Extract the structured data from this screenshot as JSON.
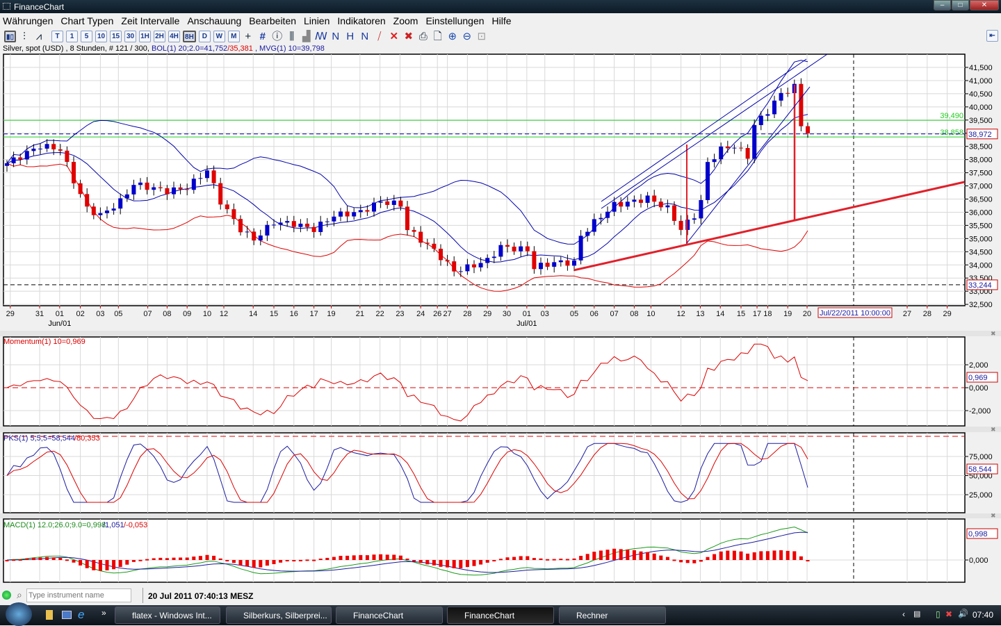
{
  "window": {
    "title": "FinanceChart",
    "controls": [
      "–",
      "□",
      "✕"
    ]
  },
  "menu": [
    "Währungen",
    "Chart Typen",
    "Zeit Intervalle",
    "Anschauung",
    "Bearbeiten",
    "Linien",
    "Indikatoren",
    "Zoom",
    "Einstellungen",
    "Hilfe"
  ],
  "toolbar": {
    "intervals": [
      "T",
      "1",
      "5",
      "10",
      "15",
      "30",
      "1H",
      "2H",
      "4H",
      "8H",
      "D",
      "W",
      "M"
    ],
    "active_interval": "8H"
  },
  "info": {
    "instrument": "Silver, spot (USD) , 8 Stunden, # 121 / 300, ",
    "bol": "BOL(1) 20;2.0=41,752",
    "bol_lower": "/35,381",
    "mvg": " , MVG(1) 10=39,798"
  },
  "colors": {
    "up": "#0000cc",
    "down": "#e00000",
    "band": "#0000aa",
    "lower_band": "#e00000",
    "trend": "#e0202a",
    "level": "#22cc22"
  },
  "chart_data": [
    {
      "type": "candlestick",
      "title": "Silver, spot (USD), 8 Stunden",
      "ylim": [
        32.5,
        41.8
      ],
      "yticks": [
        "41,500",
        "41,000",
        "40,500",
        "40,000",
        "39,500",
        "39,000",
        "38,500",
        "38,000",
        "37,500",
        "37,000",
        "36,500",
        "36,000",
        "35,500",
        "35,000",
        "34,500",
        "34,000",
        "33,500",
        "33,000",
        "32,500"
      ],
      "ytick_values": [
        41.5,
        41,
        40.5,
        40,
        39.5,
        39,
        38.5,
        38,
        37.5,
        37,
        36.5,
        36,
        35.5,
        35,
        34.5,
        34,
        33.5,
        33,
        32.5
      ],
      "xticks": [
        "29",
        "31",
        "01",
        "02",
        "03",
        "05",
        "07",
        "08",
        "09",
        "10",
        "12",
        "14",
        "15",
        "16",
        "17",
        "19",
        "21",
        "22",
        "23",
        "24",
        "26",
        "27",
        "28",
        "29",
        "30",
        "01",
        "03",
        "05",
        "06",
        "07",
        "08",
        "10",
        "12",
        "13",
        "14",
        "15",
        "17",
        "18",
        "19",
        "20",
        "27",
        "28",
        "29"
      ],
      "xtick_index": [
        0.5,
        4.9,
        7.9,
        11,
        14,
        16.7,
        21.1,
        24,
        27,
        30,
        32.5,
        36.9,
        40,
        43,
        46,
        48.6,
        52.9,
        55.9,
        58.9,
        62,
        64.5,
        66,
        69,
        72,
        74.9,
        77.9,
        80.6,
        85,
        88,
        91,
        94,
        96.5,
        101,
        103.9,
        106.9,
        110,
        112.4,
        114,
        117,
        119.9,
        134.9,
        137.9,
        140.9
      ],
      "month_labels": [
        {
          "label": "Jun/01",
          "index": 7.9
        },
        {
          "label": "Jul/01",
          "index": 77.9
        }
      ],
      "cursor_date": "Jul/22/2011 10:00:00",
      "close_keyframes": [
        [
          0,
          37.86
        ],
        [
          5,
          38.52
        ],
        [
          8,
          38.39
        ],
        [
          10,
          37.2
        ],
        [
          12,
          36.14
        ],
        [
          14,
          35.88
        ],
        [
          17,
          36.41
        ],
        [
          19,
          37.07
        ],
        [
          24,
          36.8
        ],
        [
          27,
          36.93
        ],
        [
          30,
          37.6
        ],
        [
          32,
          36.41
        ],
        [
          35,
          35.35
        ],
        [
          37,
          34.96
        ],
        [
          40,
          35.62
        ],
        [
          43,
          35.56
        ],
        [
          46,
          35.35
        ],
        [
          49,
          35.88
        ],
        [
          53,
          36.01
        ],
        [
          56,
          36.41
        ],
        [
          59,
          36.28
        ],
        [
          60,
          35.35
        ],
        [
          64,
          34.56
        ],
        [
          67,
          33.77
        ],
        [
          69,
          33.9
        ],
        [
          72,
          34.17
        ],
        [
          74,
          34.69
        ],
        [
          78,
          34.56
        ],
        [
          79,
          33.9
        ],
        [
          82,
          34.09
        ],
        [
          85,
          34.09
        ],
        [
          86,
          35.09
        ],
        [
          88,
          35.62
        ],
        [
          91,
          36.28
        ],
        [
          94,
          36.41
        ],
        [
          96,
          36.54
        ],
        [
          99,
          36.14
        ],
        [
          101,
          35.35
        ],
        [
          103,
          35.88
        ],
        [
          104,
          36.41
        ],
        [
          105,
          37.86
        ],
        [
          107,
          38.39
        ],
        [
          109,
          38.52
        ],
        [
          111,
          38.12
        ],
        [
          112,
          39.31
        ],
        [
          114,
          39.84
        ],
        [
          116,
          40.5
        ],
        [
          118,
          40.76
        ],
        [
          119,
          39.31
        ],
        [
          120,
          39.05
        ]
      ],
      "levels": [
        {
          "label": "39,490",
          "value": 39.49
        },
        {
          "label": "38,858",
          "value": 38.858
        }
      ],
      "last_price": "38,972",
      "last_price_value": 38.972,
      "low_marker": "33,244",
      "low_marker_value": 33.244,
      "trendline": [
        [
          85,
          33.8
        ],
        [
          143.5,
          37.15
        ]
      ]
    },
    {
      "type": "line",
      "title": "Momentum(1) 10=0,969",
      "yticks": [
        "2,000",
        "0,000",
        "-2,000"
      ],
      "ytick_values": [
        2,
        0,
        -2
      ],
      "period": 10,
      "last": "0,969"
    },
    {
      "type": "line",
      "title_k": "PKS(1) 5;5;5=58,544",
      "title_d": "/80,353",
      "yticks": [
        "75,000",
        "50,000",
        "25,000"
      ],
      "ytick_values": [
        75,
        50,
        25
      ],
      "last": "58,544"
    },
    {
      "type": "line+bar",
      "title_a": "MACD(1) 12.0;26.0;9.0=0,998",
      "title_b": "/1,051",
      "title_c": "/-0,053",
      "yticks": [
        "0,000"
      ],
      "ytick_values": [
        0
      ],
      "last": "0,998"
    }
  ],
  "status": {
    "search_placeholder": "Type instrument name",
    "datetime": "20 Jul 2011 07:40:13 MESZ"
  },
  "taskbar": {
    "tasks": [
      "flatex - Windows Int...",
      "Silberkurs, Silberprei...",
      "FinanceChart",
      "FinanceChart",
      "Rechner"
    ],
    "clock": "07:40"
  }
}
